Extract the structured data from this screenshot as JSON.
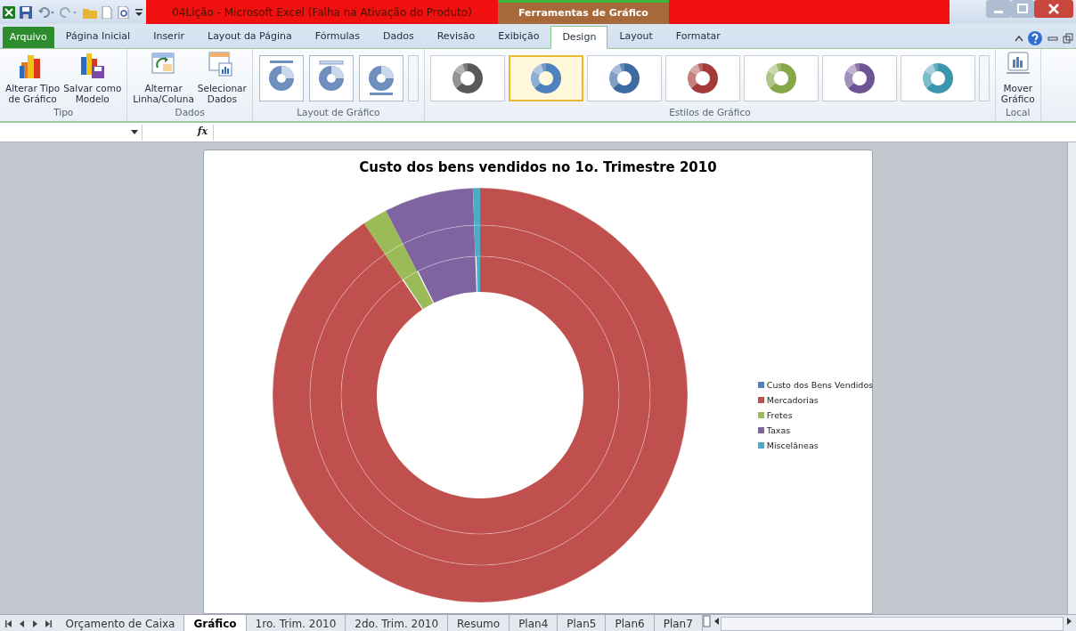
{
  "window": {
    "title": "04Lição - Microsoft Excel (Falha na Ativação do Produto)",
    "context_group": "Ferramentas de Gráfico"
  },
  "ribbon_tabs": [
    {
      "label": "Arquivo",
      "kind": "file",
      "selected": false
    },
    {
      "label": "Página Inicial",
      "kind": "tab",
      "selected": false
    },
    {
      "label": "Inserir",
      "kind": "tab",
      "selected": false
    },
    {
      "label": "Layout da Página",
      "kind": "tab",
      "selected": false
    },
    {
      "label": "Fórmulas",
      "kind": "tab",
      "selected": false
    },
    {
      "label": "Dados",
      "kind": "tab",
      "selected": false
    },
    {
      "label": "Revisão",
      "kind": "tab",
      "selected": false
    },
    {
      "label": "Exibição",
      "kind": "tab",
      "selected": false
    },
    {
      "label": "Design",
      "kind": "context",
      "selected": true
    },
    {
      "label": "Layout",
      "kind": "context",
      "selected": false
    },
    {
      "label": "Formatar",
      "kind": "context",
      "selected": false
    }
  ],
  "ribbon_groups": [
    {
      "label": "Tipo",
      "kind": "buttons",
      "buttons": [
        {
          "lines": [
            "Alterar Tipo",
            "de Gráfico"
          ]
        },
        {
          "lines": [
            "Salvar como",
            "Modelo"
          ]
        }
      ]
    },
    {
      "label": "Dados",
      "kind": "buttons",
      "buttons": [
        {
          "lines": [
            "Alternar",
            "Linha/Coluna"
          ]
        },
        {
          "lines": [
            "Selecionar",
            "Dados"
          ]
        }
      ]
    },
    {
      "label": "Layout de Gráfico",
      "kind": "layouts",
      "layouts": [
        {
          "kind": "title-top"
        },
        {
          "kind": "title-box"
        },
        {
          "kind": "label-bottom"
        }
      ]
    },
    {
      "label": "Estilos de Gráfico",
      "kind": "styles",
      "styles": [
        {
          "color": "#595959",
          "selected": false
        },
        {
          "color": "#4f81bd",
          "selected": true
        },
        {
          "color": "#3d6aa3",
          "selected": false
        },
        {
          "color": "#a33b38",
          "selected": false
        },
        {
          "color": "#86a848",
          "selected": false
        },
        {
          "color": "#6e5494",
          "selected": false
        },
        {
          "color": "#3b97ad",
          "selected": false
        }
      ]
    },
    {
      "label": "Local",
      "kind": "buttons",
      "buttons": [
        {
          "lines": [
            "Mover",
            "Gráfico"
          ]
        }
      ]
    }
  ],
  "formula_bar": {
    "function_label": "fx"
  },
  "chart": {
    "title": "Custo dos bens vendidos no 1o. Trimestre 2010",
    "legend": [
      {
        "label": "Custo dos Bens Vendidos",
        "color": "#4f81bd"
      },
      {
        "label": "Mercadorias",
        "color": "#c0504d"
      },
      {
        "label": "Fretes",
        "color": "#9bbb59"
      },
      {
        "label": "Taxas",
        "color": "#8064a2"
      },
      {
        "label": "Miscelâneas",
        "color": "#4bacc6"
      }
    ]
  },
  "sheet_tabs": [
    {
      "label": "Orçamento de Caixa",
      "selected": false
    },
    {
      "label": "Gráfico",
      "selected": true
    },
    {
      "label": "1ro. Trim. 2010",
      "selected": false
    },
    {
      "label": "2do. Trim. 2010",
      "selected": false
    },
    {
      "label": "Resumo",
      "selected": false
    },
    {
      "label": "Plan4",
      "selected": false
    },
    {
      "label": "Plan5",
      "selected": false
    },
    {
      "label": "Plan6",
      "selected": false
    },
    {
      "label": "Plan7",
      "selected": false
    }
  ]
}
